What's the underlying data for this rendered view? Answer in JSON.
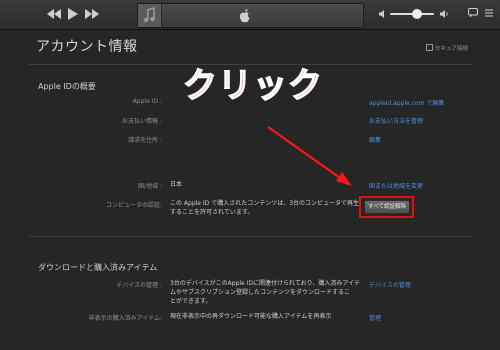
{
  "toolbar": {
    "icons": [
      "rewind-icon",
      "play-icon",
      "fast-forward-icon",
      "music-note-icon",
      "apple-logo-icon",
      "volume-icon",
      "speech-bubble-icon",
      "list-icon"
    ]
  },
  "page": {
    "title": "アカウント情報",
    "secure_label": "セキュア接続"
  },
  "apple_id_section": {
    "heading": "Apple IDの概要",
    "rows": [
      {
        "label": "Apple ID :",
        "value": "",
        "link": "appleid.apple.com で編集"
      },
      {
        "label": "お支払い情報 :",
        "value": "",
        "link": "お支払い方法を管理"
      },
      {
        "label": "請求先住所 :",
        "value": "",
        "link": "編集"
      },
      {
        "label": "国/地域 :",
        "value": "日本",
        "link": "国または地域を変更"
      }
    ],
    "computer_auth": {
      "label": "コンピュータの認証:",
      "line1": "この Apple ID で購入されたコンテンツは、3台のコンピュータで再生",
      "line2": "することを許可されています。",
      "button": "すべて認証解除"
    }
  },
  "annotation": {
    "text": "クリック",
    "color": "#ff1515"
  },
  "downloads_section": {
    "heading": "ダウンロードと購入済みアイテム",
    "devices": {
      "label": "デバイスの管理 :",
      "line1": "3台のデバイスがこのApple IDに関連付けられており、購入済みアイテ",
      "line2": "ムやサブスクリプション登録したコンテンツをダウンロードするこ",
      "line3": "とができます。",
      "link": "デバイスの管理"
    },
    "hidden": {
      "label": "非表示の購入済みアイテム:",
      "value": "現在非表示中の再ダウンロード可能な購入アイテムを再表示",
      "link": "管理"
    }
  },
  "colors": {
    "background": "#262626",
    "link": "#4d8fe0",
    "highlight": "#e20f0f"
  }
}
